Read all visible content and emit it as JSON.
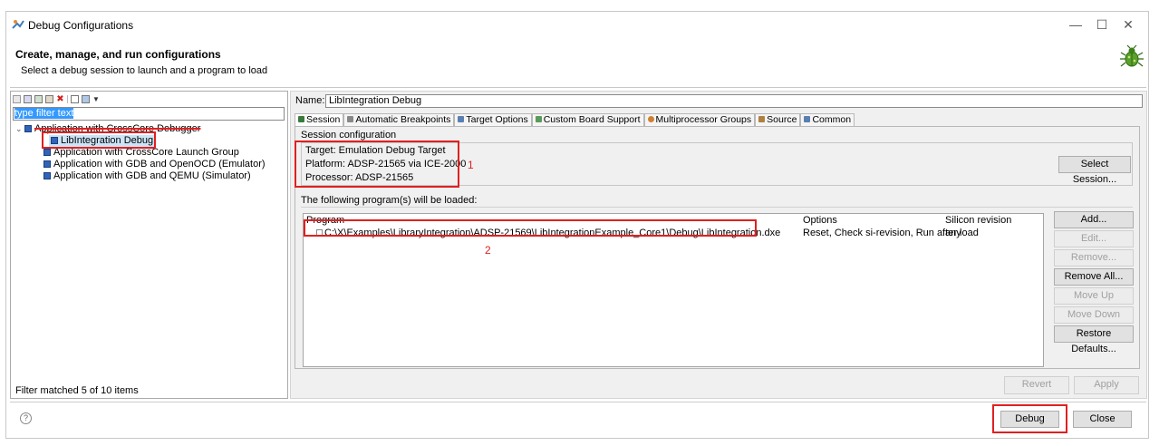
{
  "window": {
    "title": "Debug Configurations",
    "controls": {
      "minimize": "—",
      "maximize": "☐",
      "close": "✕"
    }
  },
  "header": {
    "title": "Create, manage, and run configurations",
    "subtitle": "Select a debug session to launch and a program to load"
  },
  "left_panel": {
    "filter_text": "type filter text",
    "tree": [
      {
        "label": "Application with CrossCore Debugger",
        "expanded": true,
        "level": 0
      },
      {
        "label": "LibIntegration Debug",
        "level": 1,
        "selected": true
      },
      {
        "label": "Application with CrossCore Launch Group",
        "level": 0
      },
      {
        "label": "Application with GDB and OpenOCD (Emulator)",
        "level": 0
      },
      {
        "label": "Application with GDB and QEMU (Simulator)",
        "level": 0
      }
    ],
    "status": "Filter matched 5 of 10 items"
  },
  "right_panel": {
    "name_label": "Name:",
    "name_value": "LibIntegration Debug",
    "tabs": [
      {
        "label": "Session",
        "icon_color": "#3a7a3a"
      },
      {
        "label": "Automatic Breakpoints",
        "icon_color": "#888888"
      },
      {
        "label": "Target Options",
        "icon_color": "#5a7fb0"
      },
      {
        "label": "Custom Board Support",
        "icon_color": "#5a9a5a"
      },
      {
        "label": "Multiprocessor Groups",
        "icon_color": "#d08030"
      },
      {
        "label": "Source",
        "icon_color": "#b08040"
      },
      {
        "label": "Common",
        "icon_color": "#5a7fb0"
      }
    ],
    "session_config_label": "Session configuration",
    "target": "Target: Emulation Debug Target",
    "platform": "Platform: ADSP-21565 via ICE-2000",
    "processor": "Processor: ADSP-21565",
    "select_session_button": "Select Session...",
    "programs_label": "The following program(s) will be loaded:",
    "columns": {
      "program": "Program",
      "options": "Options",
      "silicon": "Silicon revision"
    },
    "program_row": {
      "program": "C:\\X\\Examples\\LibraryIntegration\\ADSP-21569\\LibIntegrationExample_Core1\\Debug\\LibIntegration.dxe",
      "options": "Reset, Check si-revision, Run after load",
      "silicon": "any"
    },
    "side_buttons": {
      "add": "Add...",
      "edit": "Edit...",
      "remove": "Remove...",
      "remove_all": "Remove All...",
      "move_up": "Move Up",
      "move_down": "Move Down",
      "restore_defaults": "Restore Defaults..."
    },
    "revert": "Revert",
    "apply": "Apply"
  },
  "annotations": {
    "label1": "1",
    "label2": "2"
  },
  "footer": {
    "help": "?",
    "debug": "Debug",
    "close": "Close"
  },
  "colors": {
    "annotation": "#e02020",
    "selection": "#3399ff"
  }
}
